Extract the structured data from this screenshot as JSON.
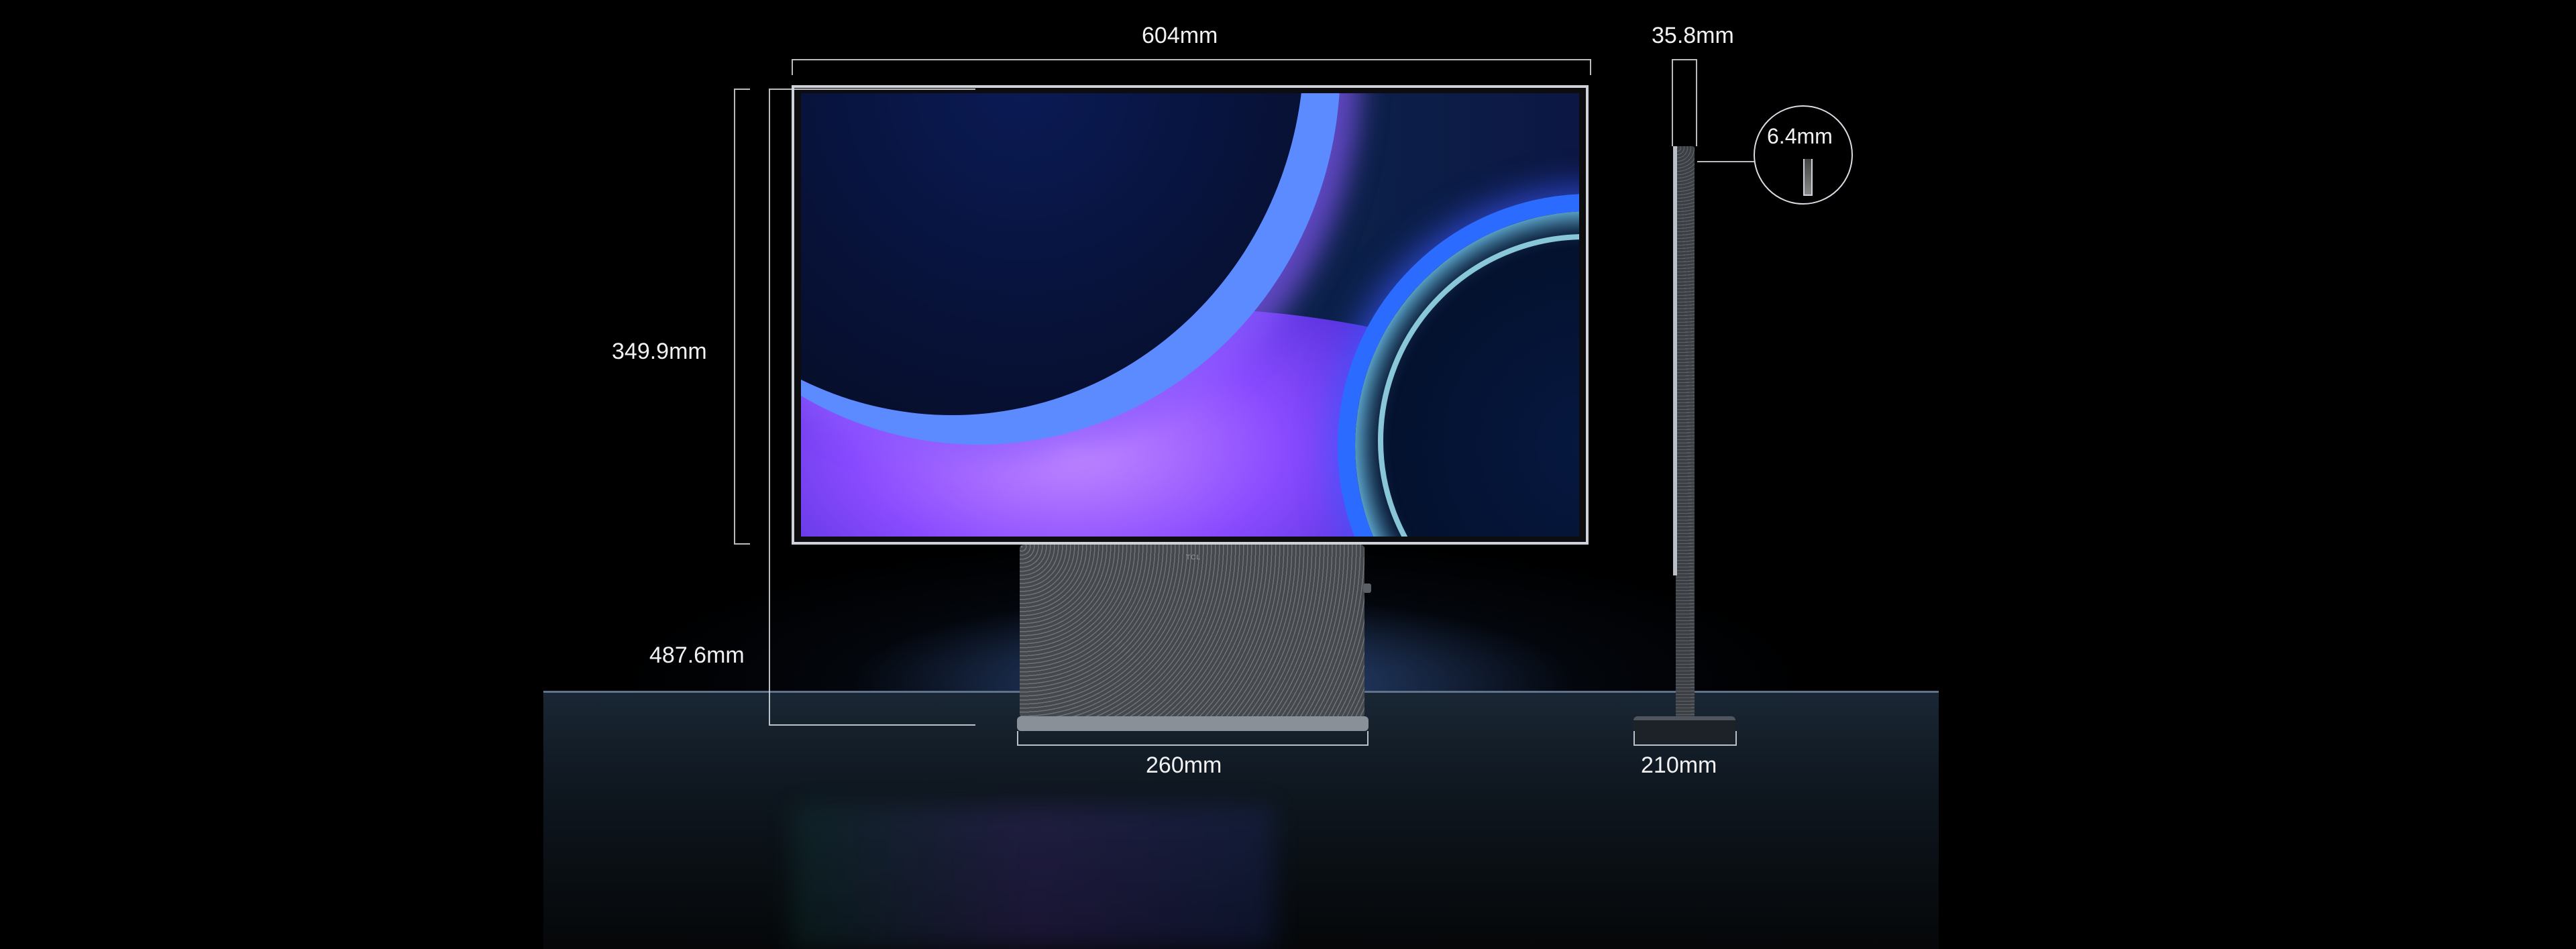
{
  "dimensions": {
    "width_front": "604mm",
    "screen_height": "349.9mm",
    "total_height": "487.6mm",
    "base_width": "260mm",
    "depth_total": "35.8mm",
    "panel_thickness": "6.4mm",
    "side_base_depth": "210mm"
  },
  "brand_mark": "TCL",
  "icons": {
    "thickness_callout": "magnifier-circle-icon"
  }
}
